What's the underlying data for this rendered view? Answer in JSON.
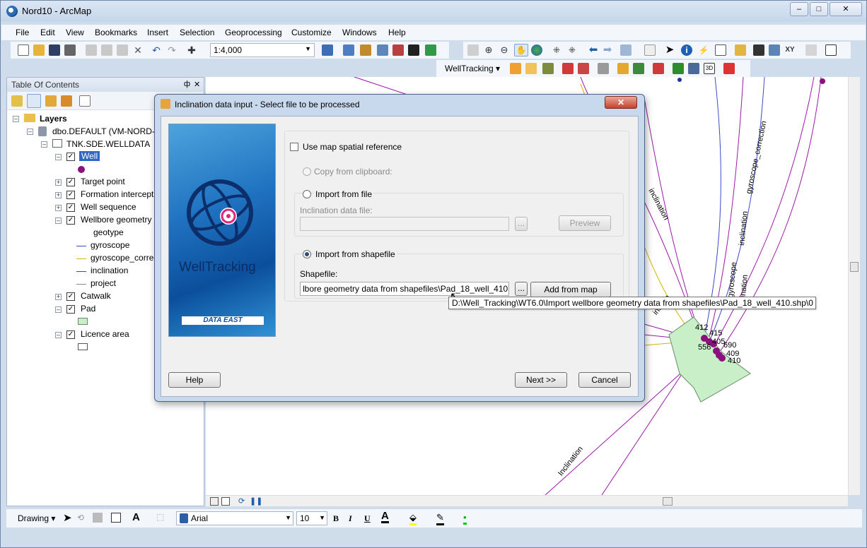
{
  "window": {
    "title": "Nord10 - ArcMap",
    "min_label": "–",
    "max_label": "□",
    "close_label": "✕"
  },
  "menu": [
    "File",
    "Edit",
    "View",
    "Bookmarks",
    "Insert",
    "Selection",
    "Geoprocessing",
    "Customize",
    "Windows",
    "Help"
  ],
  "toolbar": {
    "scale": "1:4,000",
    "welltracking_label": "WellTracking ▾"
  },
  "toc": {
    "title": "Table Of Contents",
    "pin": "ф",
    "close": "✕",
    "layers_label": "Layers",
    "db_label": "dbo.DEFAULT (VM-NORD-1",
    "dataset_label": "TNK.SDE.WELLDATA",
    "well_label": "Well",
    "items": [
      "Target point",
      "Formation intercept",
      "Well sequence",
      "Wellbore geometry"
    ],
    "geotype_label": "geotype",
    "legend": [
      {
        "label": "gyroscope",
        "color": "#3b4bc8"
      },
      {
        "label": "gyroscope_correction",
        "color": "#d6b400"
      },
      {
        "label": "inclination",
        "color": "#9b1aa8"
      },
      {
        "label": "project",
        "color": "#8a8a8a"
      }
    ],
    "catwalk_label": "Catwalk",
    "pad_label": "Pad",
    "licence_label": "Licence area"
  },
  "dialog": {
    "title": "Inclination data input - Select file to be processed",
    "close": "✕",
    "logo_text": "WellTracking",
    "brand": "DATA EAST",
    "use_map_ref": "Use map spatial reference",
    "copy_clipboard": "Copy from clipboard:",
    "import_file": "Import from file",
    "inclination_file_label": "Inclination data file:",
    "browse": "...",
    "preview": "Preview",
    "import_shapefile": "Import from shapefile",
    "shapefile_label": "Shapefile:",
    "shapefile_value": "lbore geometry data from shapefiles\\Pad_18_well_410.shp\\0",
    "add_from_map": "Add from map",
    "help": "Help",
    "next": "Next >>",
    "cancel": "Cancel"
  },
  "tooltip": "D:\\Well_Tracking\\WT6.0\\Import wellbore geometry data from shapefiles\\Pad_18_well_410.shp\\0",
  "map": {
    "labels": [
      "inclination",
      "gyroscope_correction",
      "inclination",
      "gyroscope",
      "inclination",
      "ination",
      "Inclination"
    ],
    "well_ids": [
      "412",
      "415",
      "405",
      "690",
      "409",
      "410",
      "556"
    ]
  },
  "drawbar": {
    "drawing_label": "Drawing ▾",
    "font": "Arial",
    "size": "10",
    "bold": "B",
    "italic": "I",
    "underline": "U"
  }
}
